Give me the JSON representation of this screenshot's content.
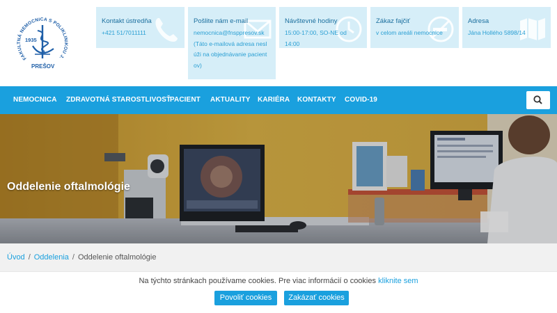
{
  "logo": {
    "ring_text": "FAKULTNÁ NEMOCNICA S POLIKLINIKOU J.A.REIMANA",
    "year": "1935",
    "city": "PREŠOV"
  },
  "info_boxes": [
    {
      "title": "Kontakt ústredňa",
      "lines": [
        "+421 51/7011111"
      ],
      "icon": "phone-icon"
    },
    {
      "title": "Pošlite nám e-mail",
      "lines": [
        "nemocnica@fnsppresov.sk",
        "(Táto e-mailová adresa nesl",
        "úži na objednávanie pacient",
        "ov)"
      ],
      "icon": "envelope-icon"
    },
    {
      "title": "Návštevné hodiny",
      "lines": [
        "15:00-17:00, SO-NE od 14:00"
      ],
      "icon": "clock-icon"
    },
    {
      "title": "Zákaz fajčiť",
      "lines": [
        "v celom areáli nemocnice"
      ],
      "icon": "no-smoking-icon"
    },
    {
      "title": "Adresa",
      "lines": [
        "Jána Hollého 5898/14"
      ],
      "icon": "map-icon"
    }
  ],
  "nav": {
    "items": [
      "NEMOCNICA",
      "ZDRAVOTNÁ STAROSTLIVOSŤ",
      "PACIENT",
      "AKTUALITY",
      "KARIÉRA",
      "KONTAKTY",
      "COVID-19"
    ],
    "search_icon": "search-icon"
  },
  "hero": {
    "title": "Oddelenie oftalmológie"
  },
  "breadcrumb": {
    "home": "Úvod",
    "section": "Oddelenia",
    "current": "Oddelenie oftalmológie",
    "separator": "/"
  },
  "cookie": {
    "text": "Na týchto stránkach používame cookies. Pre viac informácií o cookies",
    "link": "kliknite sem",
    "accept": "Povoliť cookies",
    "reject": "Zakázať cookies"
  },
  "colors": {
    "accent": "#1aa0de",
    "info_bg": "#d6eef8",
    "logo": "#1f5fa8"
  }
}
